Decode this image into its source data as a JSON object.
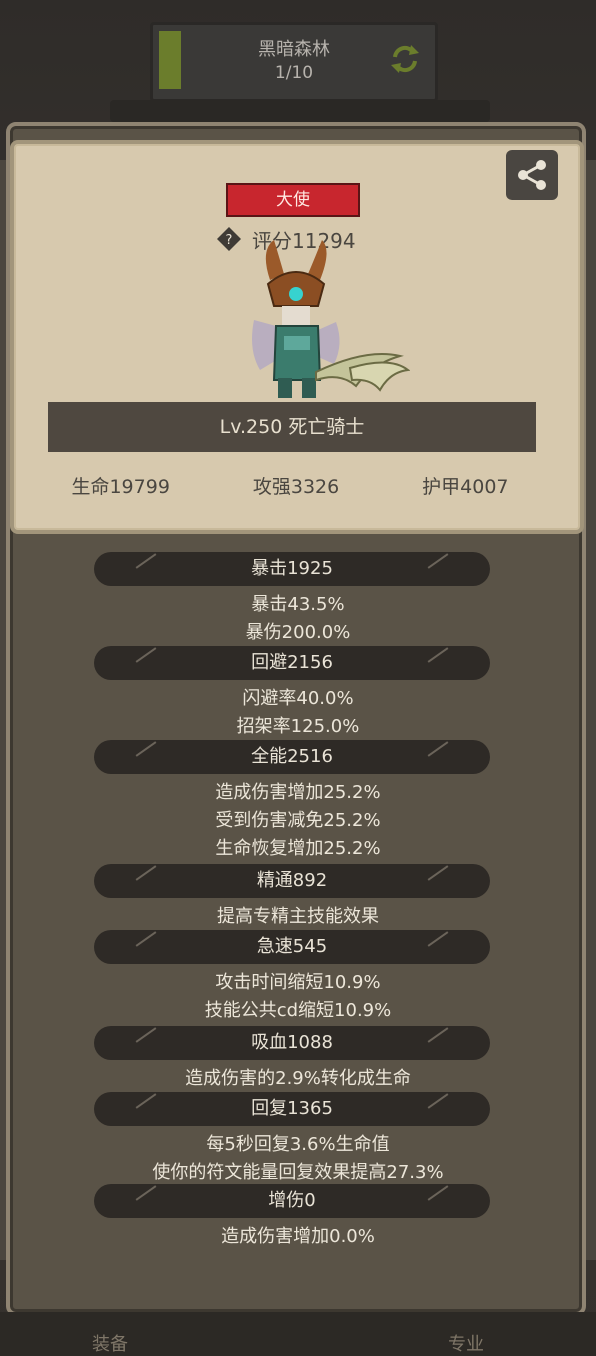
{
  "location": {
    "name": "黑暗森林",
    "progress": "1/10"
  },
  "hero": {
    "rank": "大使",
    "score": "评分11294",
    "name_level": "Lv.250 死亡骑士",
    "main_stats": [
      "生命19799",
      "攻强3326",
      "护甲4007"
    ]
  },
  "stat_groups": [
    {
      "header": "暴击1925",
      "lines": [
        "暴击43.5%",
        "暴伤200.0%"
      ]
    },
    {
      "header": "回避2156",
      "lines": [
        "闪避率40.0%",
        "招架率125.0%"
      ]
    },
    {
      "header": "全能2516",
      "lines": [
        "造成伤害增加25.2%",
        "受到伤害减免25.2%",
        "生命恢复增加25.2%"
      ]
    },
    {
      "header": "精通892",
      "lines": [
        "提高专精主技能效果"
      ]
    },
    {
      "header": "急速545",
      "lines": [
        "攻击时间缩短10.9%",
        "技能公共cd缩短10.9%"
      ]
    },
    {
      "header": "吸血1088",
      "lines": [
        "造成伤害的2.9%转化成生命"
      ]
    },
    {
      "header": "回复1365",
      "lines": [
        "每5秒回复3.6%生命值",
        "使你的符文能量回复效果提高27.3%"
      ]
    },
    {
      "header": "增伤0",
      "lines": [
        "造成伤害增加0.0%"
      ]
    }
  ],
  "bottom_tabs": [
    "装备",
    "专业"
  ],
  "colors": {
    "rank_red": "#c8262e",
    "panel_bg": "#5a5347",
    "card_bg": "#d7c9ae"
  },
  "icons": [
    "refresh-icon",
    "share-icon",
    "help-icon"
  ]
}
